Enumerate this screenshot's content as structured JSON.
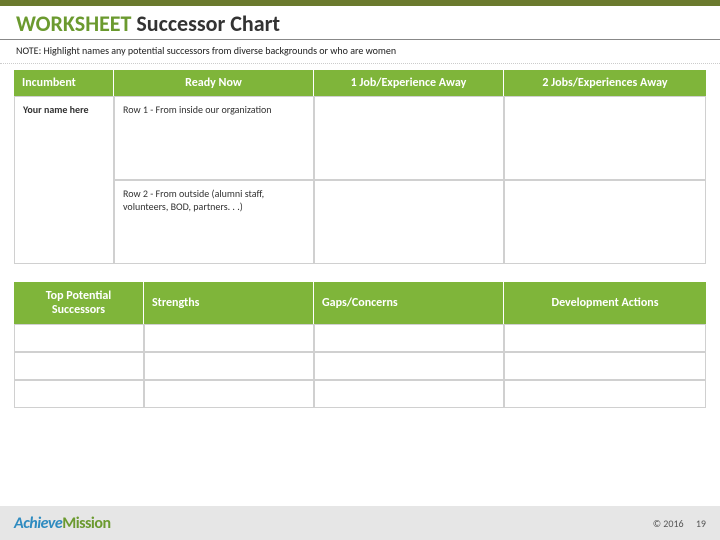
{
  "title": {
    "accent": "WORKSHEET",
    "rest": " Successor Chart"
  },
  "note": "NOTE:  Highlight names any potential successors from diverse backgrounds or who are women",
  "table1": {
    "headers": [
      "Incumbent",
      "Ready Now",
      "1 Job/Experience Away",
      "2 Jobs/Experiences Away"
    ],
    "incumbent_label": "Your name here",
    "row1_text": "Row 1 - From inside our organization",
    "row2_text": "Row 2 - From outside (alumni staff, volunteers, BOD, partners. . .)"
  },
  "table2": {
    "headers": [
      "Top Potential Successors",
      "Strengths",
      "Gaps/Concerns",
      "Development Actions"
    ]
  },
  "footer": {
    "logo_a": "Achieve",
    "logo_b": "Mission",
    "copyright": "© 2016",
    "page": "19"
  },
  "chart_data": {
    "type": "table",
    "title": "WORKSHEET Successor Chart",
    "note": "Highlight names any potential successors from diverse backgrounds or who are women",
    "tables": [
      {
        "columns": [
          "Incumbent",
          "Ready Now",
          "1 Job/Experience Away",
          "2 Jobs/Experiences Away"
        ],
        "rows": [
          [
            "Your name here",
            "Row 1 - From inside our organization",
            "",
            ""
          ],
          [
            "",
            "Row 2 - From outside (alumni staff, volunteers, BOD, partners. . .)",
            "",
            ""
          ]
        ]
      },
      {
        "columns": [
          "Top Potential Successors",
          "Strengths",
          "Gaps/Concerns",
          "Development Actions"
        ],
        "rows": [
          [
            "",
            "",
            "",
            ""
          ],
          [
            "",
            "",
            "",
            ""
          ],
          [
            "",
            "",
            "",
            ""
          ]
        ]
      }
    ]
  }
}
